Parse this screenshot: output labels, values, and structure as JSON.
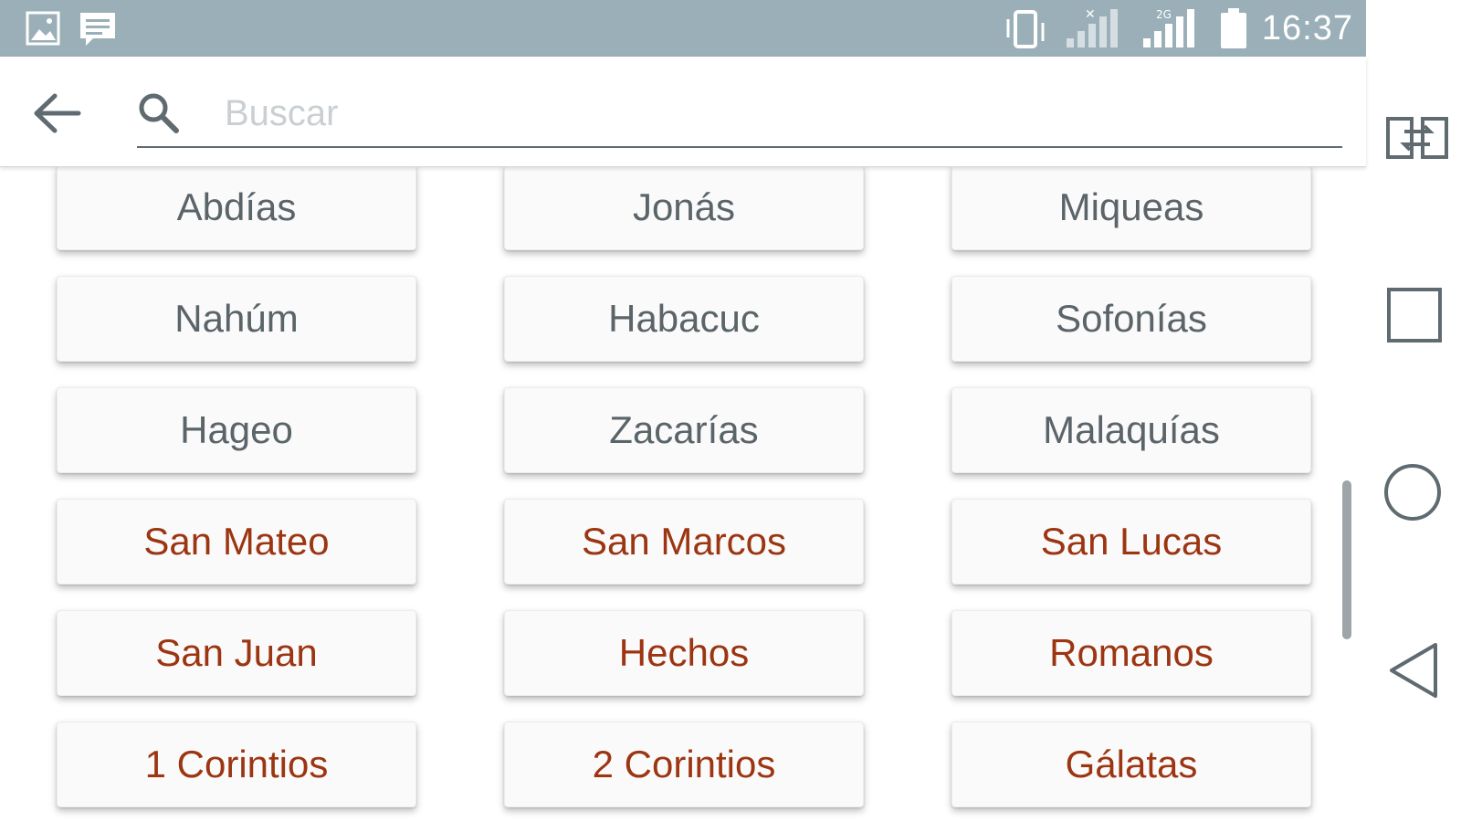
{
  "status_bar": {
    "time": "16:37",
    "icons": [
      "image-icon",
      "message-icon",
      "vibrate-icon",
      "signal-no-service-icon",
      "signal-2g-icon",
      "battery-icon"
    ]
  },
  "search": {
    "placeholder": "Buscar",
    "value": ""
  },
  "books": [
    {
      "label": "Abdías",
      "testament": "old"
    },
    {
      "label": "Jonás",
      "testament": "old"
    },
    {
      "label": "Miqueas",
      "testament": "old"
    },
    {
      "label": "Nahúm",
      "testament": "old"
    },
    {
      "label": "Habacuc",
      "testament": "old"
    },
    {
      "label": "Sofonías",
      "testament": "old"
    },
    {
      "label": "Hageo",
      "testament": "old"
    },
    {
      "label": "Zacarías",
      "testament": "old"
    },
    {
      "label": "Malaquías",
      "testament": "old"
    },
    {
      "label": "San Mateo",
      "testament": "new"
    },
    {
      "label": "San Marcos",
      "testament": "new"
    },
    {
      "label": "San Lucas",
      "testament": "new"
    },
    {
      "label": "San Juan",
      "testament": "new"
    },
    {
      "label": "Hechos",
      "testament": "new"
    },
    {
      "label": "Romanos",
      "testament": "new"
    },
    {
      "label": "1 Corintios",
      "testament": "new"
    },
    {
      "label": "2 Corintios",
      "testament": "new"
    },
    {
      "label": "Gálatas",
      "testament": "new"
    }
  ],
  "colors": {
    "status_bar": "#9aafb7",
    "old_testament_text": "#5a6469",
    "new_testament_text": "#9c3511",
    "button_background": "#fafafa"
  },
  "nav_bar": {
    "icons": [
      "screen-switch-icon",
      "recents-square-icon",
      "home-circle-icon",
      "back-triangle-icon"
    ]
  }
}
